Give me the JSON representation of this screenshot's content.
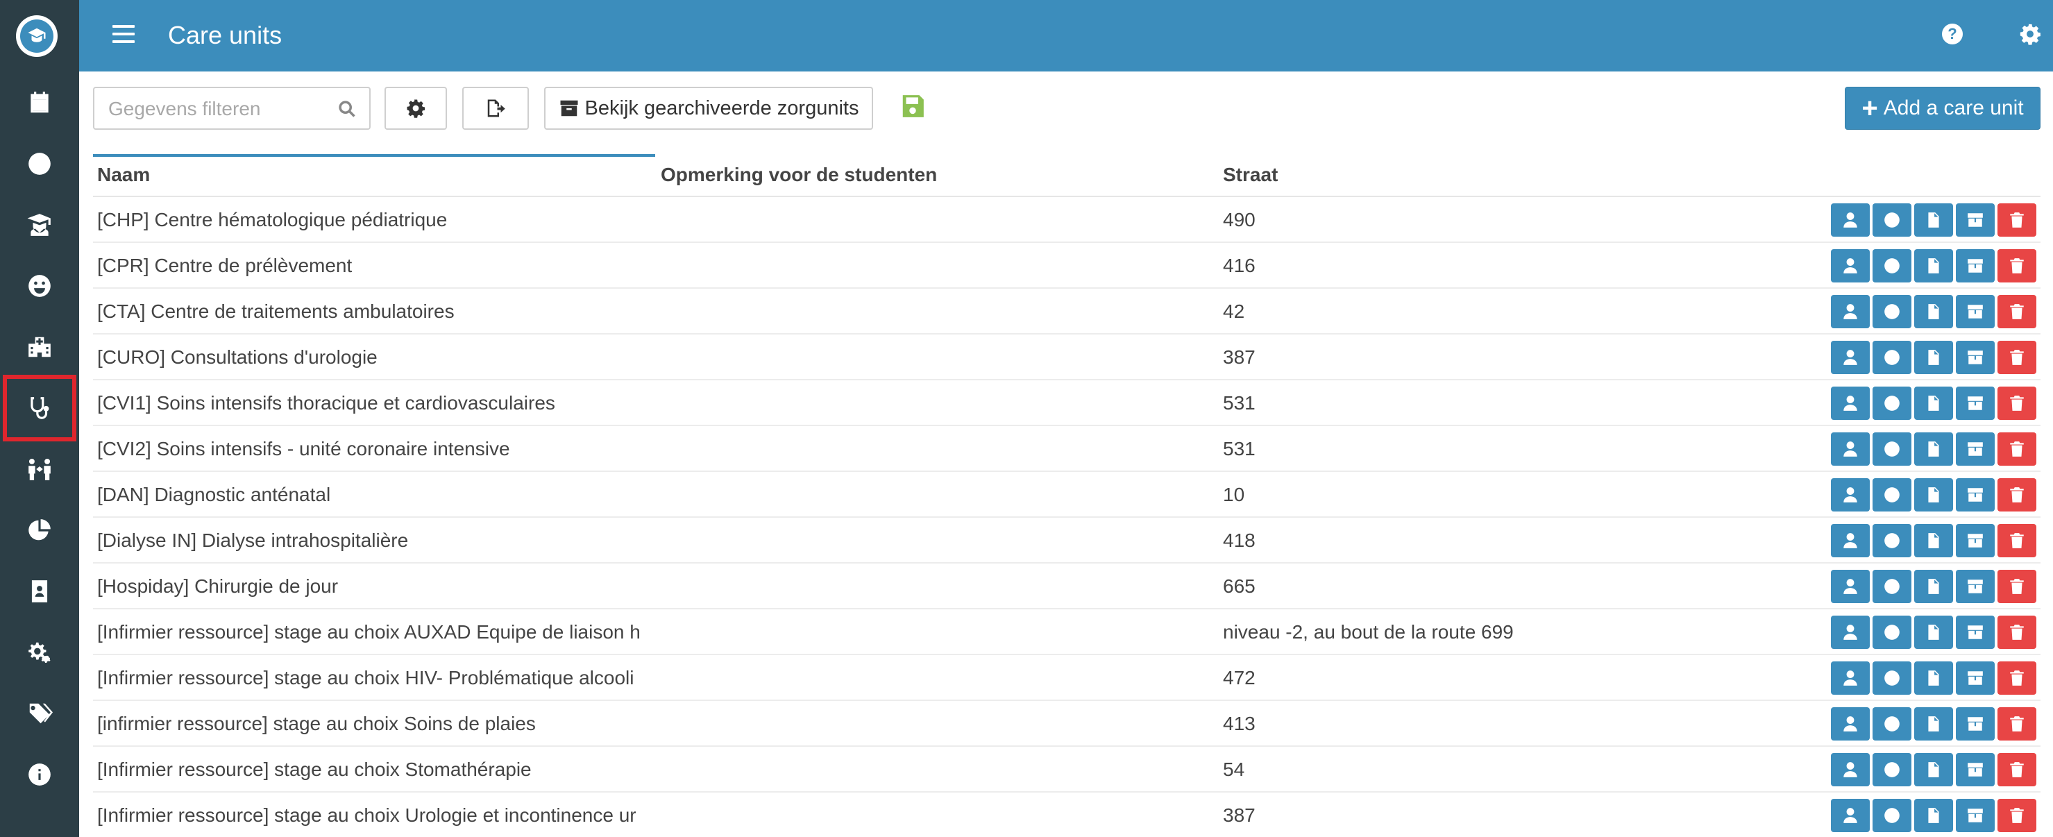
{
  "header": {
    "title": "Care units"
  },
  "toolbar": {
    "filter_placeholder": "Gegevens filteren",
    "archived_label": "Bekijk gearchiveerde zorgunits",
    "add_label": "Add a care unit"
  },
  "table": {
    "columns": [
      "Naam",
      "Opmerking voor de studenten",
      "Straat"
    ],
    "rows": [
      {
        "name": "[CHP] Centre hématologique pédiatrique",
        "street": "490"
      },
      {
        "name": "[CPR] Centre de prélèvement",
        "street": "416"
      },
      {
        "name": "[CTA] Centre de traitements ambulatoires",
        "street": "42"
      },
      {
        "name": "[CURO] Consultations d'urologie",
        "street": "387"
      },
      {
        "name": "[CVI1] Soins intensifs thoracique et cardiovasculaires",
        "street": "531"
      },
      {
        "name": "[CVI2] Soins intensifs - unité coronaire intensive",
        "street": "531"
      },
      {
        "name": "[DAN] Diagnostic anténatal",
        "street": "10"
      },
      {
        "name": "[Dialyse IN] Dialyse intrahospitalière",
        "street": "418"
      },
      {
        "name": "[Hospiday] Chirurgie de jour",
        "street": "665"
      },
      {
        "name": "[Infirmier ressource] stage au choix  AUXAD Equipe de liaison h",
        "street": "niveau -2, au bout de la route 699"
      },
      {
        "name": "[Infirmier ressource] stage au choix HIV- Problématique alcooli",
        "street": "472"
      },
      {
        "name": "[infirmier ressource] stage au choix Soins de plaies",
        "street": "413"
      },
      {
        "name": "[Infirmier ressource] stage au choix Stomathérapie",
        "street": "54"
      },
      {
        "name": "[Infirmier ressource] stage au choix Urologie et incontinence ur",
        "street": "387"
      }
    ]
  },
  "icons": {
    "sidebar": [
      "calendar-icon",
      "clock-icon",
      "graduate-icon",
      "smile-icon",
      "hospital-icon",
      "stethoscope-icon",
      "people-arrows-icon",
      "pie-chart-icon",
      "id-badge-icon",
      "cogs-icon",
      "tags-icon",
      "info-icon"
    ],
    "row_actions": [
      "user-icon",
      "clock-icon",
      "file-icon",
      "archive-icon",
      "trash-icon"
    ]
  },
  "colors": {
    "primary": "#3c8dbc",
    "sidebar": "#2c3e46",
    "danger": "#e84545",
    "save": "#8cc152",
    "active_outline": "#e0262d"
  }
}
